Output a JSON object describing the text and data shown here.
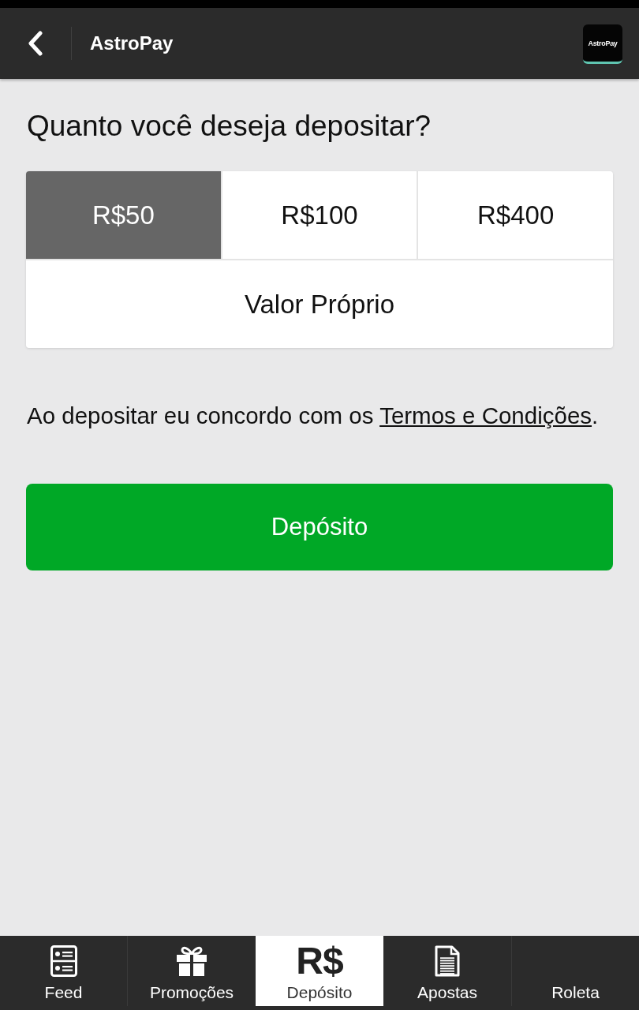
{
  "header": {
    "title": "AstroPay",
    "logo_text": "AstroPay"
  },
  "heading": "Quanto você deseja depositar?",
  "amounts": [
    {
      "label": "R$50",
      "selected": true
    },
    {
      "label": "R$100",
      "selected": false
    },
    {
      "label": "R$400",
      "selected": false
    }
  ],
  "custom_amount": {
    "label": "Valor Próprio",
    "selected": false
  },
  "terms": {
    "text": "Ao depositar eu concordo com os",
    "link": "Termos e Condições",
    "end": "."
  },
  "deposit_button": {
    "label": "Depósito"
  },
  "bottom_nav": [
    {
      "label": "Feed",
      "selected": false
    },
    {
      "label": "Promoções",
      "selected": false
    },
    {
      "label": "Depósito",
      "selected": true,
      "icon_text": "R$"
    },
    {
      "label": "Apostas",
      "selected": false
    },
    {
      "label": "Roleta",
      "selected": false
    }
  ]
}
